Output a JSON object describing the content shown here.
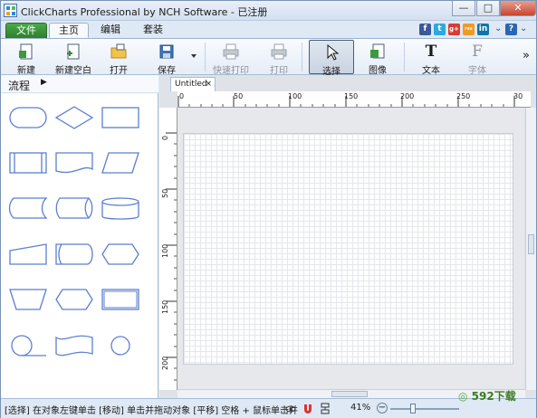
{
  "window": {
    "title": "ClickCharts Professional by NCH Software - 已注册",
    "minimize": "—",
    "maximize": "□",
    "close": "✕"
  },
  "tabs": {
    "file": "文件",
    "home": "主页",
    "edit": "编辑",
    "suite": "套装"
  },
  "ribbon": {
    "new": "新建",
    "new_blank": "新建空白",
    "open": "打开",
    "save": "保存",
    "quick_print": "快速打印",
    "print": "打印",
    "select": "选择",
    "image": "图像",
    "text": "文本",
    "font": "字体",
    "more": "»"
  },
  "header_icons": {
    "facebook": "f",
    "twitter": "t",
    "google": "g+",
    "rss": "rss",
    "linkedin": "in",
    "dropdown": "⌄",
    "help": "?"
  },
  "left_panel": {
    "category": "流程",
    "arrow": "▶"
  },
  "document": {
    "tab_name": "Untitled",
    "close": "×"
  },
  "ruler": {
    "top_labels": [
      "0",
      "50",
      "100",
      "150",
      "200",
      "250",
      "30"
    ],
    "left_labels": [
      "0",
      "50",
      "100",
      "150",
      "200"
    ]
  },
  "status": {
    "text": "[选择] 在对象左键单击 [移动] 单击并拖动对象 [平移] 空格 + 鼠标单击并",
    "zoom": "41%",
    "zoom_out": "−",
    "zoom_in": "+"
  },
  "watermark": {
    "prefix": "592",
    "suffix": "下载"
  },
  "colors": {
    "shape_stroke": "#5b7fd0",
    "file_tab": "#3c993c",
    "accent": "#2d4f7c"
  }
}
